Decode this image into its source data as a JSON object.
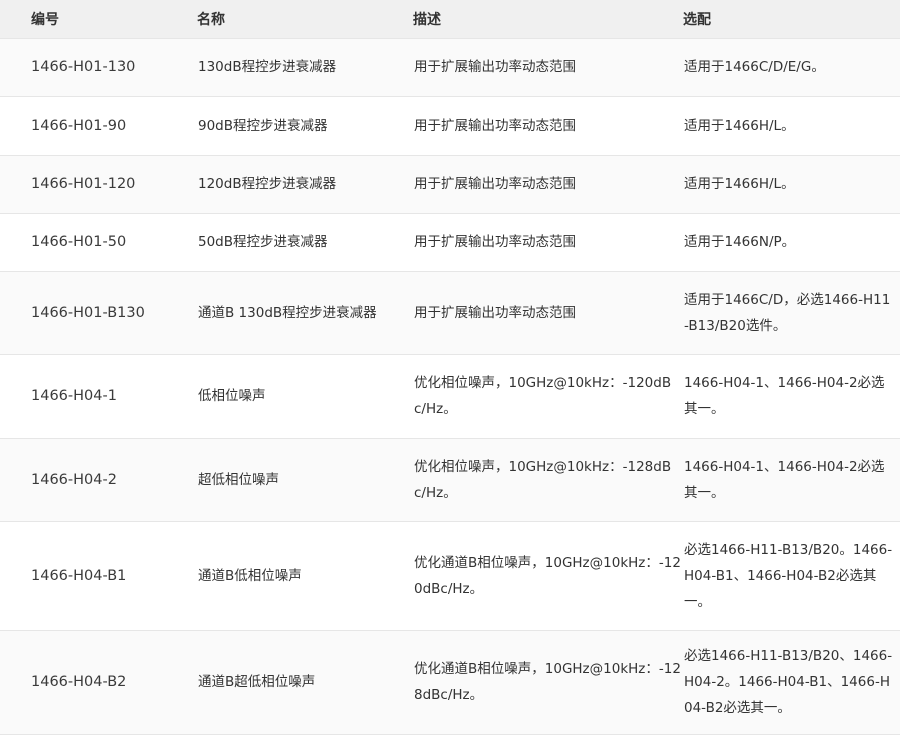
{
  "table": {
    "headers": [
      "编号",
      "名称",
      "描述",
      "选配"
    ],
    "rows": [
      {
        "code": "1466-H01-130",
        "name": "130dB程控步进衰减器",
        "desc": "用于扩展输出功率动态范围",
        "option": "适用于1466C/D/E/G。"
      },
      {
        "code": "1466-H01-90",
        "name": "90dB程控步进衰减器",
        "desc": "用于扩展输出功率动态范围",
        "option": "适用于1466H/L。"
      },
      {
        "code": "1466-H01-120",
        "name": "120dB程控步进衰减器",
        "desc": "用于扩展输出功率动态范围",
        "option": "适用于1466H/L。"
      },
      {
        "code": "1466-H01-50",
        "name": "50dB程控步进衰减器",
        "desc": "用于扩展输出功率动态范围",
        "option": "适用于1466N/P。"
      },
      {
        "code": "1466-H01-B130",
        "name": "通道B 130dB程控步进衰减器",
        "desc": "用于扩展输出功率动态范围",
        "option": "适用于1466C/D，必选1466-H11-B13/B20选件。"
      },
      {
        "code": "1466-H04-1",
        "name": "低相位噪声",
        "desc": "优化相位噪声，10GHz@10kHz：-120dBc/Hz。",
        "option": "1466-H04-1、1466-H04-2必选其一。"
      },
      {
        "code": "1466-H04-2",
        "name": "超低相位噪声",
        "desc": "优化相位噪声，10GHz@10kHz：-128dBc/Hz。",
        "option": "1466-H04-1、1466-H04-2必选其一。"
      },
      {
        "code": "1466-H04-B1",
        "name": "通道B低相位噪声",
        "desc": "优化通道B相位噪声，10GHz@10kHz：-120dBc/Hz。",
        "option": "必选1466-H11-B13/B20。1466-H04-B1、1466-H04-B2必选其一。"
      },
      {
        "code": "1466-H04-B2",
        "name": "通道B超低相位噪声",
        "desc": "优化通道B相位噪声，10GHz@10kHz：-128dBc/Hz。",
        "option": "必选1466-H11-B13/B20、1466-H04-2。1466-H04-B1、1466-H04-B2必选其一。"
      }
    ]
  }
}
